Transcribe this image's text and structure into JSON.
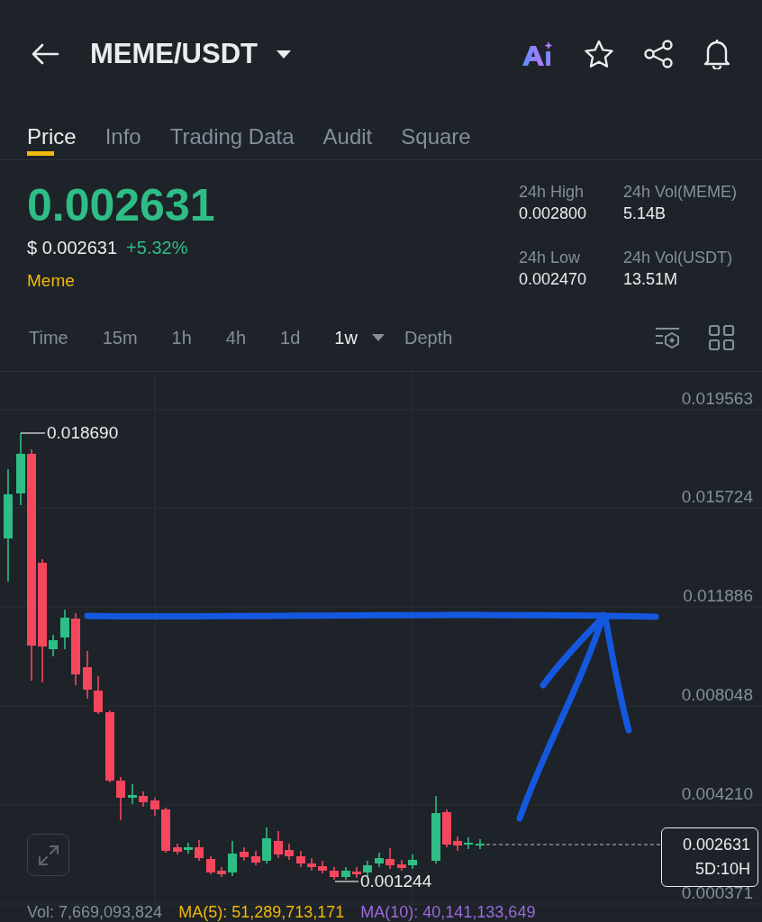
{
  "header": {
    "title": "MEME/USDT"
  },
  "tabs": [
    {
      "label": "Price",
      "selected": true
    },
    {
      "label": "Info",
      "selected": false
    },
    {
      "label": "Trading Data",
      "selected": false
    },
    {
      "label": "Audit",
      "selected": false
    },
    {
      "label": "Square",
      "selected": false
    }
  ],
  "price": {
    "last": "0.002631",
    "usd": "$ 0.002631",
    "change": "+5.32%",
    "tag": "Meme"
  },
  "stats": [
    {
      "label": "24h High",
      "value": "0.002800"
    },
    {
      "label": "24h Vol(MEME)",
      "value": "5.14B"
    },
    {
      "label": "24h Low",
      "value": "0.002470"
    },
    {
      "label": "24h Vol(USDT)",
      "value": "13.51M"
    }
  ],
  "intervals": [
    {
      "label": "Time",
      "selected": false,
      "kind": "option"
    },
    {
      "label": "15m",
      "selected": false,
      "kind": "option"
    },
    {
      "label": "1h",
      "selected": false,
      "kind": "option"
    },
    {
      "label": "4h",
      "selected": false,
      "kind": "option"
    },
    {
      "label": "1d",
      "selected": false,
      "kind": "option"
    },
    {
      "label": "1w",
      "selected": true,
      "kind": "menu"
    },
    {
      "label": "Depth",
      "selected": false,
      "kind": "option"
    }
  ],
  "chart": {
    "y_labels": [
      "0.019563",
      "0.015724",
      "0.011886",
      "0.008048",
      "0.004210",
      "0.000371"
    ],
    "high_label": "0.018690",
    "low_label": "0.001244",
    "current": {
      "price": "0.002631",
      "countdown": "5D:10H"
    }
  },
  "indicators": [
    {
      "label": "Vol: 7,669,093,824",
      "color": "#848e9c"
    },
    {
      "label": "MA(5): 51,289,713,171",
      "color": "#f0b90b"
    },
    {
      "label": "MA(10): 40,141,133,649",
      "color": "#9c6ade"
    }
  ]
}
